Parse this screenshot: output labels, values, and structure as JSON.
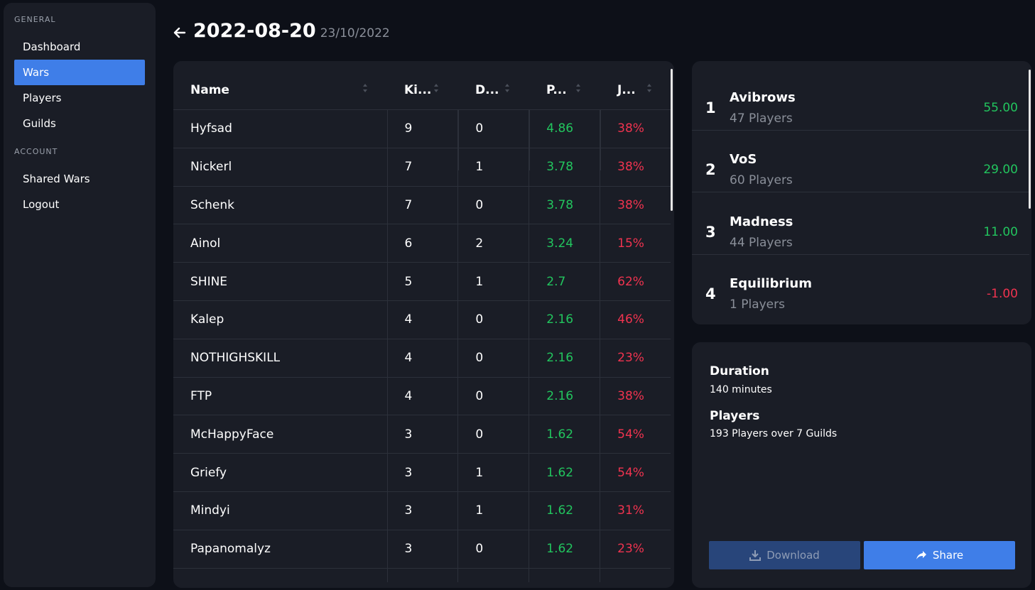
{
  "sidebar": {
    "general_label": "GENERAL",
    "account_label": "ACCOUNT",
    "items": [
      {
        "label": "Dashboard"
      },
      {
        "label": "Wars"
      },
      {
        "label": "Players"
      },
      {
        "label": "Guilds"
      }
    ],
    "account_items": [
      {
        "label": "Shared Wars"
      },
      {
        "label": "Logout"
      }
    ]
  },
  "header": {
    "title": "2022-08-20",
    "subtitle": "23/10/2022"
  },
  "table": {
    "columns": [
      "Name",
      "Ki...",
      "D...",
      "P...",
      "J..."
    ],
    "rows": [
      {
        "name": "Hyfsad",
        "k": "9",
        "d": "0",
        "p": "4.86",
        "j": "38%"
      },
      {
        "name": "Nickerl",
        "k": "7",
        "d": "1",
        "p": "3.78",
        "j": "38%"
      },
      {
        "name": "Schenk",
        "k": "7",
        "d": "0",
        "p": "3.78",
        "j": "38%"
      },
      {
        "name": "Ainol",
        "k": "6",
        "d": "2",
        "p": "3.24",
        "j": "15%"
      },
      {
        "name": "SHINE",
        "k": "5",
        "d": "1",
        "p": "2.7",
        "j": "62%"
      },
      {
        "name": "Kalep",
        "k": "4",
        "d": "0",
        "p": "2.16",
        "j": "46%"
      },
      {
        "name": "NOTHIGHSKILL",
        "k": "4",
        "d": "0",
        "p": "2.16",
        "j": "23%"
      },
      {
        "name": "FTP",
        "k": "4",
        "d": "0",
        "p": "2.16",
        "j": "38%"
      },
      {
        "name": "McHappyFace",
        "k": "3",
        "d": "0",
        "p": "1.62",
        "j": "54%"
      },
      {
        "name": "Griefy",
        "k": "3",
        "d": "1",
        "p": "1.62",
        "j": "54%"
      },
      {
        "name": "Mindyi",
        "k": "3",
        "d": "1",
        "p": "1.62",
        "j": "31%"
      },
      {
        "name": "Papanomalyz",
        "k": "3",
        "d": "0",
        "p": "1.62",
        "j": "23%"
      }
    ]
  },
  "ranking": [
    {
      "rank": "1",
      "name": "Avibrows",
      "players": "47 Players",
      "score": "55.00",
      "positive": true
    },
    {
      "rank": "2",
      "name": "VoS",
      "players": "60 Players",
      "score": "29.00",
      "positive": true
    },
    {
      "rank": "3",
      "name": "Madness",
      "players": "44 Players",
      "score": "11.00",
      "positive": true
    },
    {
      "rank": "4",
      "name": "Equilibrium",
      "players": "1 Players",
      "score": "-1.00",
      "positive": false
    }
  ],
  "info": {
    "duration_label": "Duration",
    "duration_value": "140 minutes",
    "players_label": "Players",
    "players_value": "193 Players over 7 Guilds",
    "download_label": "Download",
    "share_label": "Share"
  },
  "colors": {
    "accent": "#3f7ee8",
    "positive": "#22c55e",
    "negative": "#f0334f",
    "card": "#1a1d26",
    "background": "#0d1018"
  }
}
